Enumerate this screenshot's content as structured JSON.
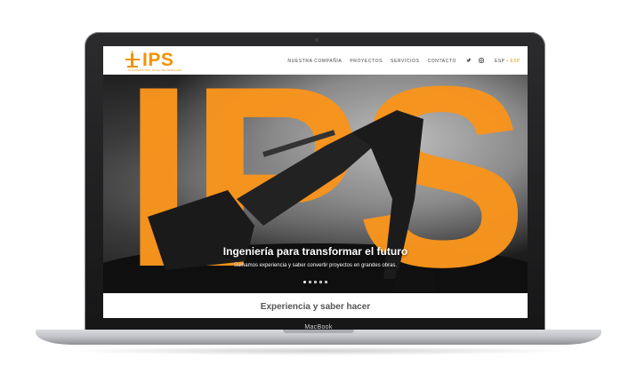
{
  "device": {
    "label": "MacBook"
  },
  "site": {
    "logo_text": "IPS",
    "logo_subtitle": "INTERNATIONAL PIPELINE SERVICES",
    "nav": [
      {
        "label": "NUESTRA COMPAÑÍA"
      },
      {
        "label": "PROYECTOS"
      },
      {
        "label": "SERVICIOS"
      },
      {
        "label": "CONTACTO"
      }
    ],
    "social_icons": [
      "twitter-icon",
      "instagram-icon"
    ],
    "language": {
      "current": "ESP",
      "separator": "•",
      "option": "ESP"
    },
    "accent_color": "#f39200"
  },
  "hero": {
    "big_text": "IPS",
    "title": "Ingeniería para transformar el futuro",
    "subtitle": "Sumamos experiencia y saber convertir proyectos en grandes obras.",
    "slides_count": 5,
    "active_slide": 1
  },
  "section": {
    "title": "Experiencia y saber hacer"
  }
}
